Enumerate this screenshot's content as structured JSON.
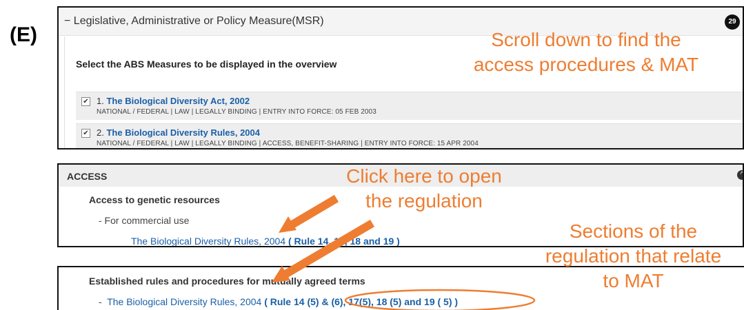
{
  "figure_label": "(E)",
  "measure_panel": {
    "title": "Legislative, Administrative or Policy Measure(MSR)",
    "collapse_glyph": "−",
    "count": "29",
    "select_heading": "Select the ABS Measures to be displayed in the overview",
    "measures": [
      {
        "num": "1.",
        "title": "The Biological Diversity Act, 2002",
        "meta": "NATIONAL / FEDERAL  |  LAW  |  LEGALLY BINDING  |  ENTRY INTO FORCE: 05 FEB 2003",
        "checked": true
      },
      {
        "num": "2.",
        "title": "The Biological Diversity Rules, 2004",
        "meta": "NATIONAL / FEDERAL  |  LAW  |  LEGALLY BINDING  |  ACCESS, BENEFIT-SHARING  |  ENTRY INTO FORCE: 15 APR 2004",
        "checked": true
      }
    ]
  },
  "access_panel": {
    "title": "ACCESS",
    "subheading": "Access to genetic resources",
    "item": "-  For commercial use",
    "link_name": "The Biological Diversity Rules, 2004",
    "link_sections": "( Rule 14, 17, 18 and 19 )"
  },
  "mat_panel": {
    "subheading": "Established rules and procedures for mutually agreed terms",
    "dash": "-",
    "link_name": "The Biological Diversity Rules, 2004",
    "link_sections": "( Rule 14 (5) & (6), 17(5), 18 (5) and 19 ( 5) )"
  },
  "annotations": {
    "scroll": [
      "Scroll down to find the",
      "access procedures & MAT"
    ],
    "click": [
      "Click here to open",
      "the regulation"
    ],
    "sections": [
      "Sections of the",
      "regulation that relate",
      "to MAT"
    ],
    "color": "#ee7d31"
  },
  "colors": {
    "link": "#1a5fa8",
    "annotation": "#ee7d31"
  }
}
